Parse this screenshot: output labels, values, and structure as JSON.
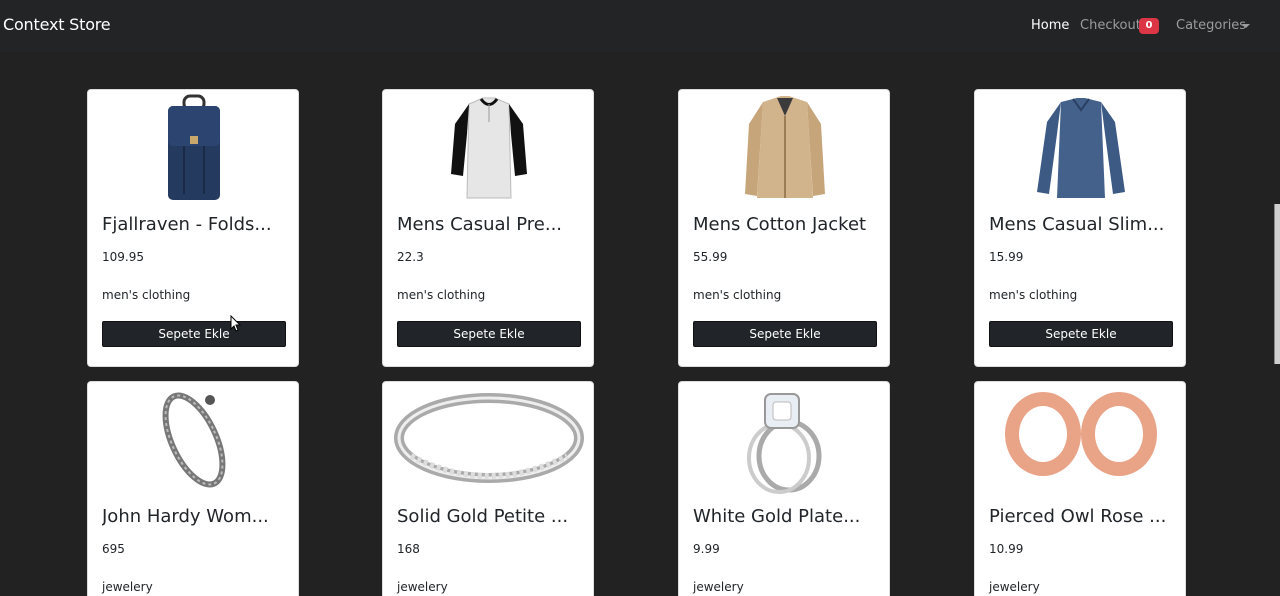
{
  "navbar": {
    "brand": "Context Store",
    "home": "Home",
    "checkout": "Checkout",
    "checkout_count": "0",
    "categories": "Categories"
  },
  "products": [
    {
      "title": "Fjallraven - Folds...",
      "price": "109.95",
      "category": "men's clothing",
      "button": "Sepete Ekle",
      "image": "backpack"
    },
    {
      "title": "Mens Casual Pre...",
      "price": "22.3",
      "category": "men's clothing",
      "button": "Sepete Ekle",
      "image": "raglan-tshirt"
    },
    {
      "title": "Mens Cotton Jacket",
      "price": "55.99",
      "category": "men's clothing",
      "button": "Sepete Ekle",
      "image": "cotton-jacket"
    },
    {
      "title": "Mens Casual Slim...",
      "price": "15.99",
      "category": "men's clothing",
      "button": "Sepete Ekle",
      "image": "slim-fit-shirt"
    },
    {
      "title": "John Hardy Wom...",
      "price": "695",
      "category": "jewelery",
      "image": "chain-bracelet"
    },
    {
      "title": "Solid Gold Petite ...",
      "price": "168",
      "category": "jewelery",
      "image": "eternity-ring"
    },
    {
      "title": "White Gold Plate...",
      "price": "9.99",
      "category": "jewelery",
      "image": "engagement-ring"
    },
    {
      "title": "Pierced Owl Rose ...",
      "price": "10.99",
      "category": "jewelery",
      "image": "rose-gold-tunnels"
    }
  ],
  "colors": {
    "background": "#222222",
    "navbar": "#222426",
    "card": "#ffffff",
    "button": "#212529",
    "badge": "#dc3545"
  }
}
